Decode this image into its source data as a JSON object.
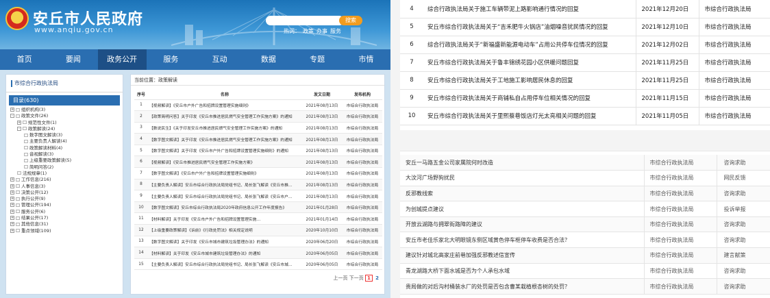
{
  "header": {
    "site_title": "安丘市人民政府",
    "site_url": "www.anqiu.gov.cn",
    "search_button": "搜索",
    "hot_label": "热词：",
    "hot_words": [
      "政策",
      "办事",
      "服务"
    ]
  },
  "nav": {
    "items": [
      "首页",
      "要闻",
      "政务公开",
      "服务",
      "互动",
      "数据",
      "专题",
      "市情"
    ],
    "active_index": 2
  },
  "sidebar": {
    "heading": "市综合行政执法局",
    "all_label": "目录(630)",
    "tree": [
      {
        "label": "组织机构(3)",
        "level": 0,
        "toggle": "+"
      },
      {
        "label": "政策文件(26)",
        "level": 0,
        "toggle": "-"
      },
      {
        "label": "规范性文件(1)",
        "level": 1,
        "toggle": "+"
      },
      {
        "label": "政策解读(24)",
        "level": 1,
        "toggle": "-"
      },
      {
        "label": "数字图文解读(3)",
        "level": 2,
        "toggle": ""
      },
      {
        "label": "主要负责人解读(4)",
        "level": 2,
        "toggle": ""
      },
      {
        "label": "政策解读材料(4)",
        "level": 2,
        "toggle": ""
      },
      {
        "label": "音视解读(3)",
        "level": 2,
        "toggle": ""
      },
      {
        "label": "上级重要政策解读(5)",
        "level": 2,
        "toggle": ""
      },
      {
        "label": "简明问答(2)",
        "level": 2,
        "toggle": ""
      },
      {
        "label": "法规规章(1)",
        "level": 1,
        "toggle": ""
      },
      {
        "label": "工作信息(216)",
        "level": 0,
        "toggle": "+"
      },
      {
        "label": "人事信息(3)",
        "level": 0,
        "toggle": "+"
      },
      {
        "label": "决策公开(12)",
        "level": 0,
        "toggle": "+"
      },
      {
        "label": "执行公开(9)",
        "level": 0,
        "toggle": "+"
      },
      {
        "label": "管理公开(194)",
        "level": 0,
        "toggle": "+"
      },
      {
        "label": "服务公开(6)",
        "level": 0,
        "toggle": "+"
      },
      {
        "label": "结果公开(17)",
        "level": 0,
        "toggle": "+"
      },
      {
        "label": "其他信息(31)",
        "level": 0,
        "toggle": "+"
      },
      {
        "label": "重点领域(109)",
        "level": 0,
        "toggle": "+"
      }
    ]
  },
  "main": {
    "breadcrumb": "当前位置：政策解读",
    "columns": [
      "序号",
      "名称",
      "发文日期",
      "发布机构"
    ],
    "rows": [
      {
        "no": "1",
        "title": "【视频解读】《安丘市户外广告和招牌设置管理实施细则》",
        "date": "2021年08月13日",
        "org": "市综合行政执法局"
      },
      {
        "no": "2",
        "title": "【政策简明问答】关于印发《安丘市推进居民燃气安全管理工作实施方案》的通知",
        "date": "2021年08月13日",
        "org": "市综合行政执法局"
      },
      {
        "no": "3",
        "title": "【数说民生】《关于印发安丘市推进居民燃气安全管理工作实施方案》的通知",
        "date": "2021年08月13日",
        "org": "市综合行政执法局"
      },
      {
        "no": "4",
        "title": "【数字图文解读】关于印发《安丘市推进居民燃气安全管理工作实施方案》的通知",
        "date": "2021年08月13日",
        "org": "市综合行政执法局"
      },
      {
        "no": "5",
        "title": "【数字图文解读】关于印发《安丘市户外广告和招牌设置管理实施细则》的通知",
        "date": "2021年08月13日",
        "org": "市综合行政执法局"
      },
      {
        "no": "6",
        "title": "【视频解读】《安丘市推进居民燃气安全管理工作实施方案》",
        "date": "2021年08月13日",
        "org": "市综合行政执法局"
      },
      {
        "no": "7",
        "title": "【数字图文解读】《安丘市户外广告和招牌设置管理实施细则》",
        "date": "2021年08月13日",
        "org": "市综合行政执法局"
      },
      {
        "no": "8",
        "title": "【主要负责人解读】安丘市综合行政执法局党组书记、局长张飞解读《安丘市推…",
        "date": "2021年08月13日",
        "org": "市综合行政执法局"
      },
      {
        "no": "9",
        "title": "【主要负责人解读】安丘市综合行政执法局党组书记、局长张飞解读《安丘市户…",
        "date": "2021年08月13日",
        "org": "市综合行政执法局"
      },
      {
        "no": "10",
        "title": "【数字图文解读】安丘市综合行政执法局2020年政府信息公开工作年度报告》",
        "date": "2021年01月28日",
        "org": "市综合行政执法局"
      },
      {
        "no": "11",
        "title": "【材料解读】关于印发《安丘市户外广告和招牌设置管理实施…",
        "date": "2021年01月14日",
        "org": "市综合行政执法局"
      },
      {
        "no": "12",
        "title": "【上级重要政策解读】《诉前》《行政处罚法》相关规定说明",
        "date": "2020年10月10日",
        "org": "市综合行政执法局"
      },
      {
        "no": "13",
        "title": "【数字图文解读】关于印发《安丘市城市建筑垃圾管理办法》的通知",
        "date": "2020年06月20日",
        "org": "市综合行政执法局"
      },
      {
        "no": "14",
        "title": "【材料解读】关于印发《安丘市城市建筑垃圾管理办法》的通知",
        "date": "2020年06月05日",
        "org": "市综合行政执法局"
      },
      {
        "no": "15",
        "title": "【主要负责人解读】安丘市综合行政执法局党组书记、局长张飞解读《安丘市城…",
        "date": "2020年06月05日",
        "org": "市综合行政执法局"
      }
    ],
    "pager": {
      "prev": "上一页",
      "next": "下一页",
      "current": "1",
      "page2": "2"
    }
  },
  "right_top": {
    "rows": [
      {
        "no": "4",
        "title": "综合行政执法局关于施工车辆带泥上路影响通行情况的回复",
        "date": "2021年12月20日",
        "org": "市综合行政执法局"
      },
      {
        "no": "5",
        "title": "安丘市综合行政执法局关于“吉禾肥牛火锅店”油烟噪音扰民情况的回复",
        "date": "2021年12月10日",
        "org": "市综合行政执法局"
      },
      {
        "no": "6",
        "title": "综合行政执法局关于“新福盛新能源电动车”占用公共停车位情况的回复",
        "date": "2021年12月02日",
        "org": "市综合行政执法局"
      },
      {
        "no": "7",
        "title": "安丘市综合行政执法局关于鲁丰锦绣花园小区供暖问题回复",
        "date": "2021年11月25日",
        "org": "市综合行政执法局"
      },
      {
        "no": "8",
        "title": "安丘市综合行政执法局关于工地施工影响居民休息的回复",
        "date": "2021年11月25日",
        "org": "市综合行政执法局"
      },
      {
        "no": "9",
        "title": "安丘市综合行政执法局关于商铺私自占用停车位相关情况的回复",
        "date": "2021年11月15日",
        "org": "市综合行政执法局"
      },
      {
        "no": "10",
        "title": "安丘市综合行政执法局关于里熙蔡巷饭店灯光太亮相关问题的回复",
        "date": "2021年11月05日",
        "org": "市综合行政执法局"
      }
    ]
  },
  "right_bottom": {
    "rows": [
      {
        "q": "安丘一马路五金公司家属院何时改造",
        "dept": "市综合行政执法局",
        "kind": "咨询求助"
      },
      {
        "q": "大汶河广场野狗扰民",
        "dept": "市综合行政执法局",
        "kind": "网民反馈"
      },
      {
        "q": "反邪教线索",
        "dept": "市综合行政执法局",
        "kind": "咨询求助"
      },
      {
        "q": "为创城提点建议",
        "dept": "市综合行政执法局",
        "kind": "投诉举报"
      },
      {
        "q": "开放云湖路与拥翠街路障的建议",
        "dept": "市综合行政执法局",
        "kind": "咨询求助"
      },
      {
        "q": "安丘市老佳乐家北大明眼镜东侧区域黄色停车框停车收费是否合法？",
        "dept": "市综合行政执法局",
        "kind": "咨询求助"
      },
      {
        "q": "建议针对城北高家庄前巷加强反邪教述信宣传",
        "dept": "市综合行政执法局",
        "kind": "建言献策"
      },
      {
        "q": "青龙湖路大桥下面水城是否为个人承包水域",
        "dept": "市综合行政执法局",
        "kind": "咨询求助"
      },
      {
        "q": "贵局做的对后沟村桶装水厂的处罚是否包含曹某栽植根杏树的处罚？",
        "dept": "市综合行政执法局",
        "kind": "咨询求助"
      }
    ]
  },
  "colors": {
    "nav_blue": "#2a6eb1",
    "nav_active": "#1d4f86",
    "search_orange": "#f29c1f"
  }
}
